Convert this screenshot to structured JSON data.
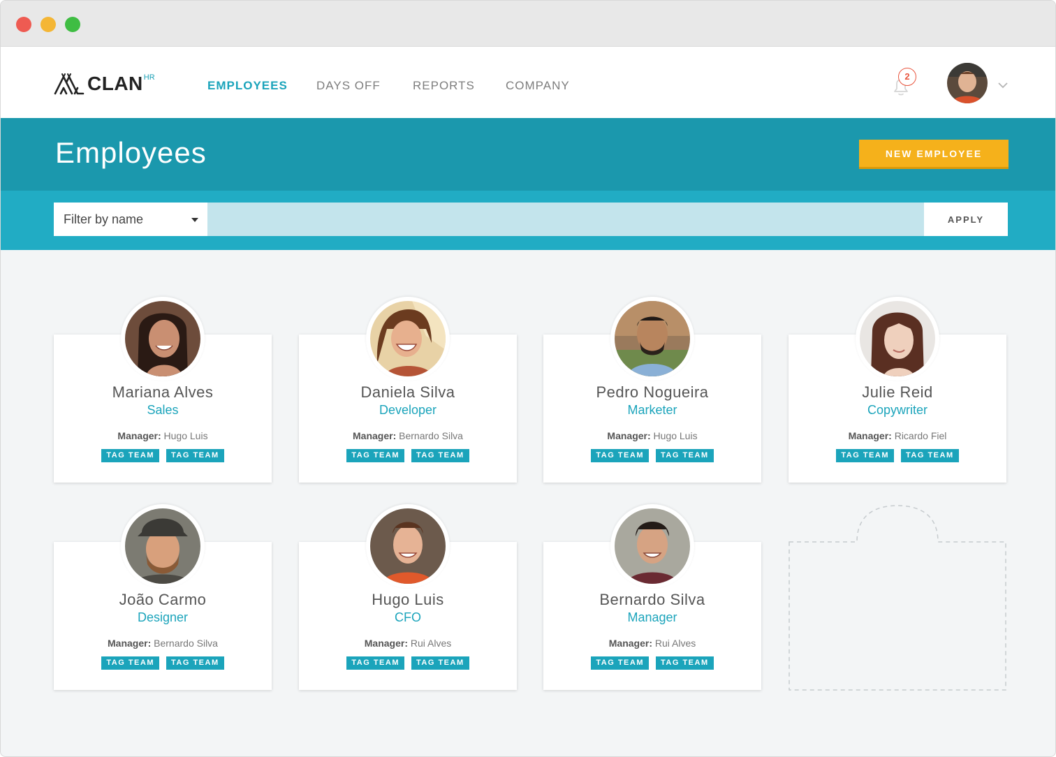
{
  "app": {
    "logo_text": "CLAN",
    "logo_sup": "HR"
  },
  "nav": {
    "items": [
      {
        "label": "EMPLOYEES",
        "active": true
      },
      {
        "label": "DAYS OFF",
        "active": false
      },
      {
        "label": "REPORTS",
        "active": false
      },
      {
        "label": "COMPANY",
        "active": false
      }
    ],
    "notifications_count": "2"
  },
  "header": {
    "title": "Employees",
    "new_button": "NEW EMPLOYEE"
  },
  "filter": {
    "select_value": "Filter by name",
    "input_value": "",
    "apply_label": "APPLY"
  },
  "colors": {
    "accent": "#1ba4bb",
    "header_band": "#1b98ad",
    "filter_band": "#21acc4",
    "primary_button": "#f5b11b",
    "notification": "#e9553e"
  },
  "employees": [
    {
      "name": "Mariana Alves",
      "role": "Sales",
      "manager_label": "Manager:",
      "manager": "Hugo Luis",
      "tags": [
        "TAG TEAM",
        "TAG TEAM"
      ]
    },
    {
      "name": "Daniela Silva",
      "role": "Developer",
      "manager_label": "Manager:",
      "manager": "Bernardo Silva",
      "tags": [
        "TAG TEAM",
        "TAG TEAM"
      ]
    },
    {
      "name": "Pedro Nogueira",
      "role": "Marketer",
      "manager_label": "Manager:",
      "manager": "Hugo Luis",
      "tags": [
        "TAG TEAM",
        "TAG TEAM"
      ]
    },
    {
      "name": "Julie Reid",
      "role": "Copywriter",
      "manager_label": "Manager:",
      "manager": "Ricardo Fiel",
      "tags": [
        "TAG TEAM",
        "TAG TEAM"
      ]
    },
    {
      "name": "João Carmo",
      "role": "Designer",
      "manager_label": "Manager:",
      "manager": "Bernardo Silva",
      "tags": [
        "TAG TEAM",
        "TAG TEAM"
      ]
    },
    {
      "name": "Hugo Luis",
      "role": "CFO",
      "manager_label": "Manager:",
      "manager": "Rui Alves",
      "tags": [
        "TAG TEAM",
        "TAG TEAM"
      ]
    },
    {
      "name": "Bernardo Silva",
      "role": "Manager",
      "manager_label": "Manager:",
      "manager": "Rui Alves",
      "tags": [
        "TAG TEAM",
        "TAG TEAM"
      ]
    }
  ]
}
